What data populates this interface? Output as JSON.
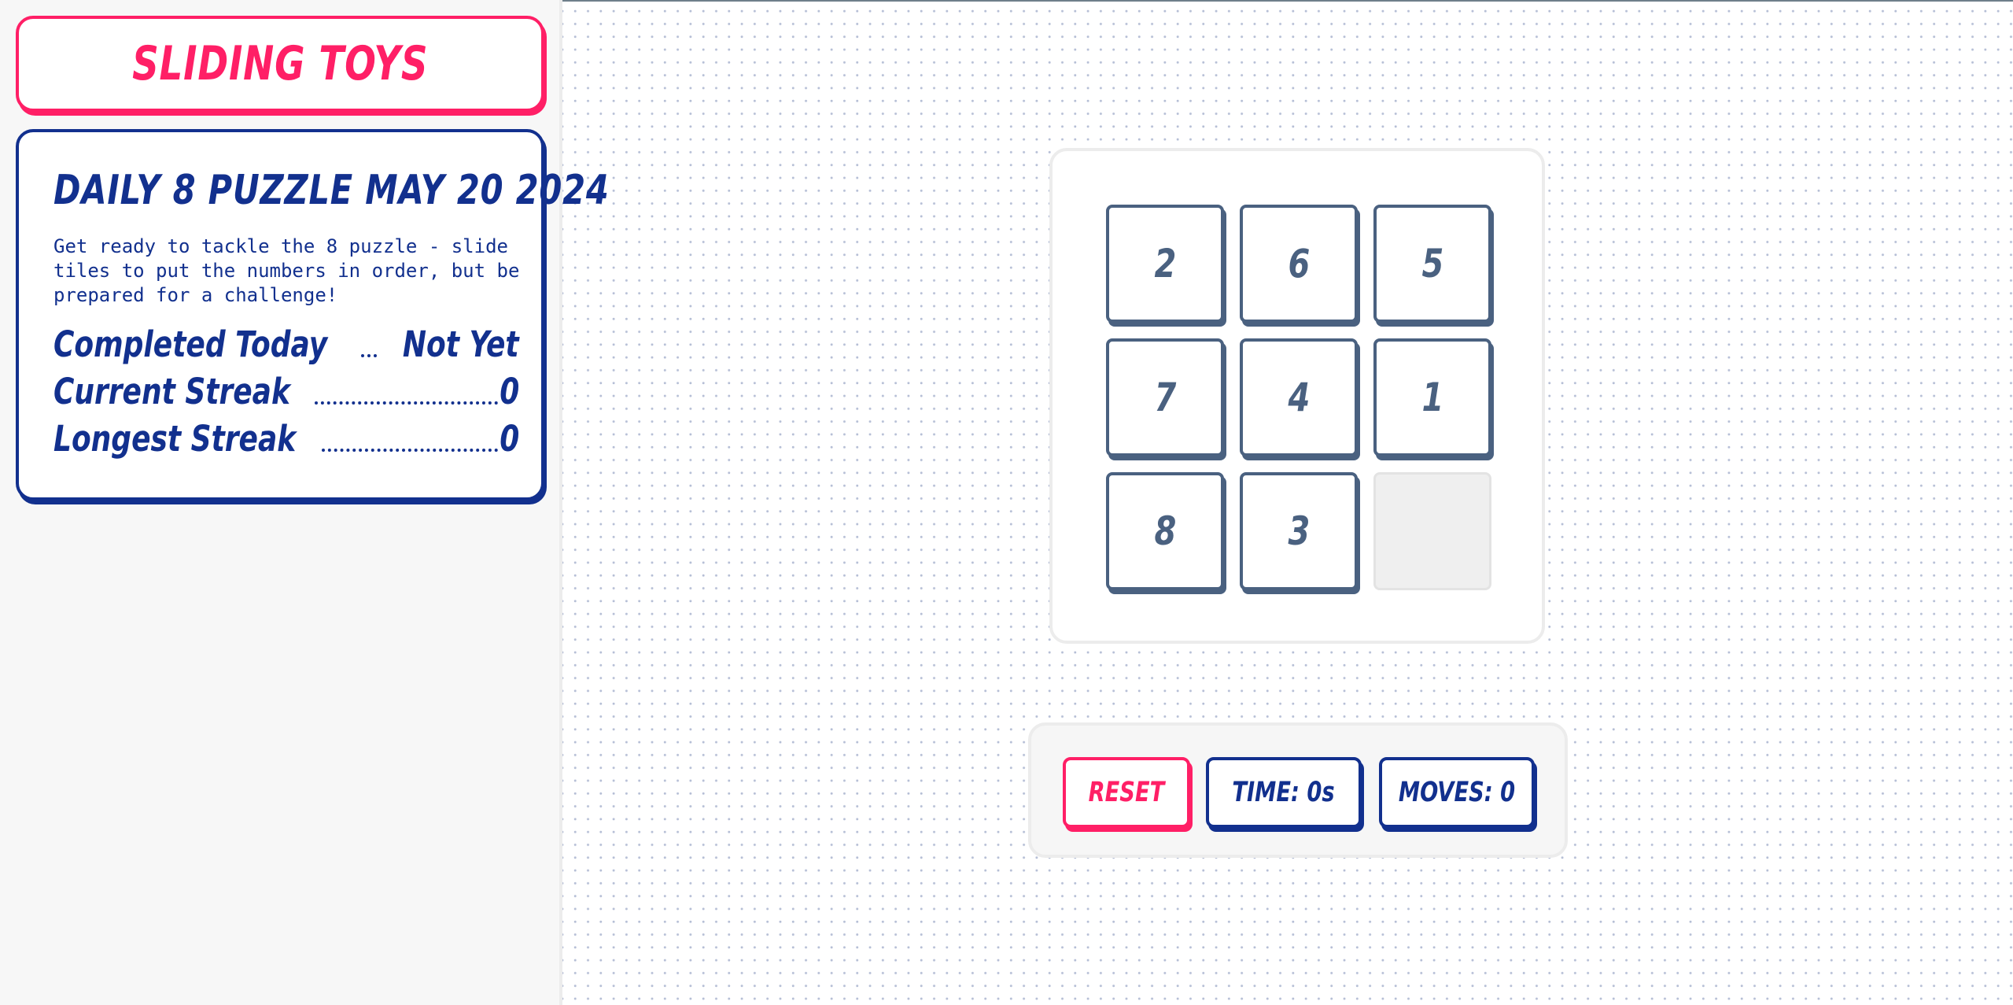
{
  "app": {
    "title": "SLIDING TOYS"
  },
  "puzzle": {
    "title": "DAILY 8 PUZZLE MAY 20 2024",
    "description": "Get ready to tackle the 8 puzzle - slide tiles to put the numbers in order, but be prepared for a challenge!"
  },
  "stats": [
    {
      "label": "Completed Today",
      "value": "Not Yet"
    },
    {
      "label": "Current Streak",
      "value": "0"
    },
    {
      "label": "Longest Streak",
      "value": "0"
    }
  ],
  "board": {
    "tiles": [
      "2",
      "6",
      "5",
      "7",
      "4",
      "1",
      "8",
      "3",
      ""
    ]
  },
  "controls": {
    "reset_label": "RESET",
    "time_label": "TIME: 0s",
    "moves_label": "MOVES: 0"
  },
  "colors": {
    "accent": "#ff1f66",
    "primary": "#12308e",
    "tile": "#4a6180",
    "empty_tile": "#efefef"
  }
}
